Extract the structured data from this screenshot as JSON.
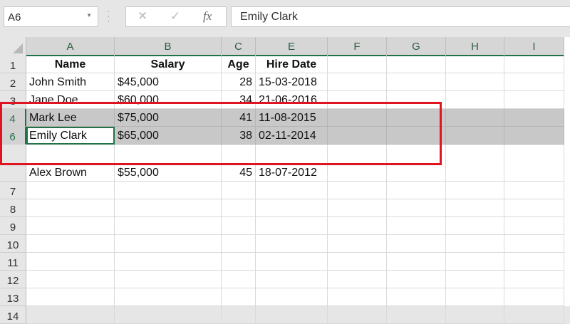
{
  "name_box": {
    "value": "A6"
  },
  "formula_bar": {
    "cancel_icon": "✕",
    "enter_icon": "✓",
    "fx_label": "fx",
    "value": "Emily Clark"
  },
  "columns": [
    "A",
    "B",
    "C",
    "E",
    "F",
    "G",
    "H",
    "I"
  ],
  "rows": [
    {
      "label": "1",
      "cells": [
        "Name",
        "Salary",
        "Age",
        "Hire Date"
      ],
      "header": true
    },
    {
      "label": "2",
      "cells": [
        "John Smith",
        "$45,000",
        "28",
        "15-03-2018"
      ]
    },
    {
      "label": "3",
      "cells": [
        "Jane Doe",
        "$60,000",
        "34",
        "21-06-2016"
      ]
    },
    {
      "label": "4",
      "cells": [
        "Mark Lee",
        "$75,000",
        "41",
        "11-08-2015"
      ],
      "selected": true
    },
    {
      "label": "6",
      "cells": [
        "Emily Clark",
        "$65,000",
        "38",
        "02-11-2014"
      ],
      "selected": true,
      "active": true
    },
    {
      "label": "",
      "cells": [
        "Alex Brown",
        "$55,000",
        "45",
        "18-07-2012"
      ],
      "tall": true
    },
    {
      "label": "7",
      "cells": []
    },
    {
      "label": "8",
      "cells": []
    },
    {
      "label": "9",
      "cells": []
    },
    {
      "label": "10",
      "cells": []
    },
    {
      "label": "11",
      "cells": []
    },
    {
      "label": "12",
      "cells": []
    },
    {
      "label": "13",
      "cells": []
    },
    {
      "label": "14",
      "cells": []
    }
  ]
}
